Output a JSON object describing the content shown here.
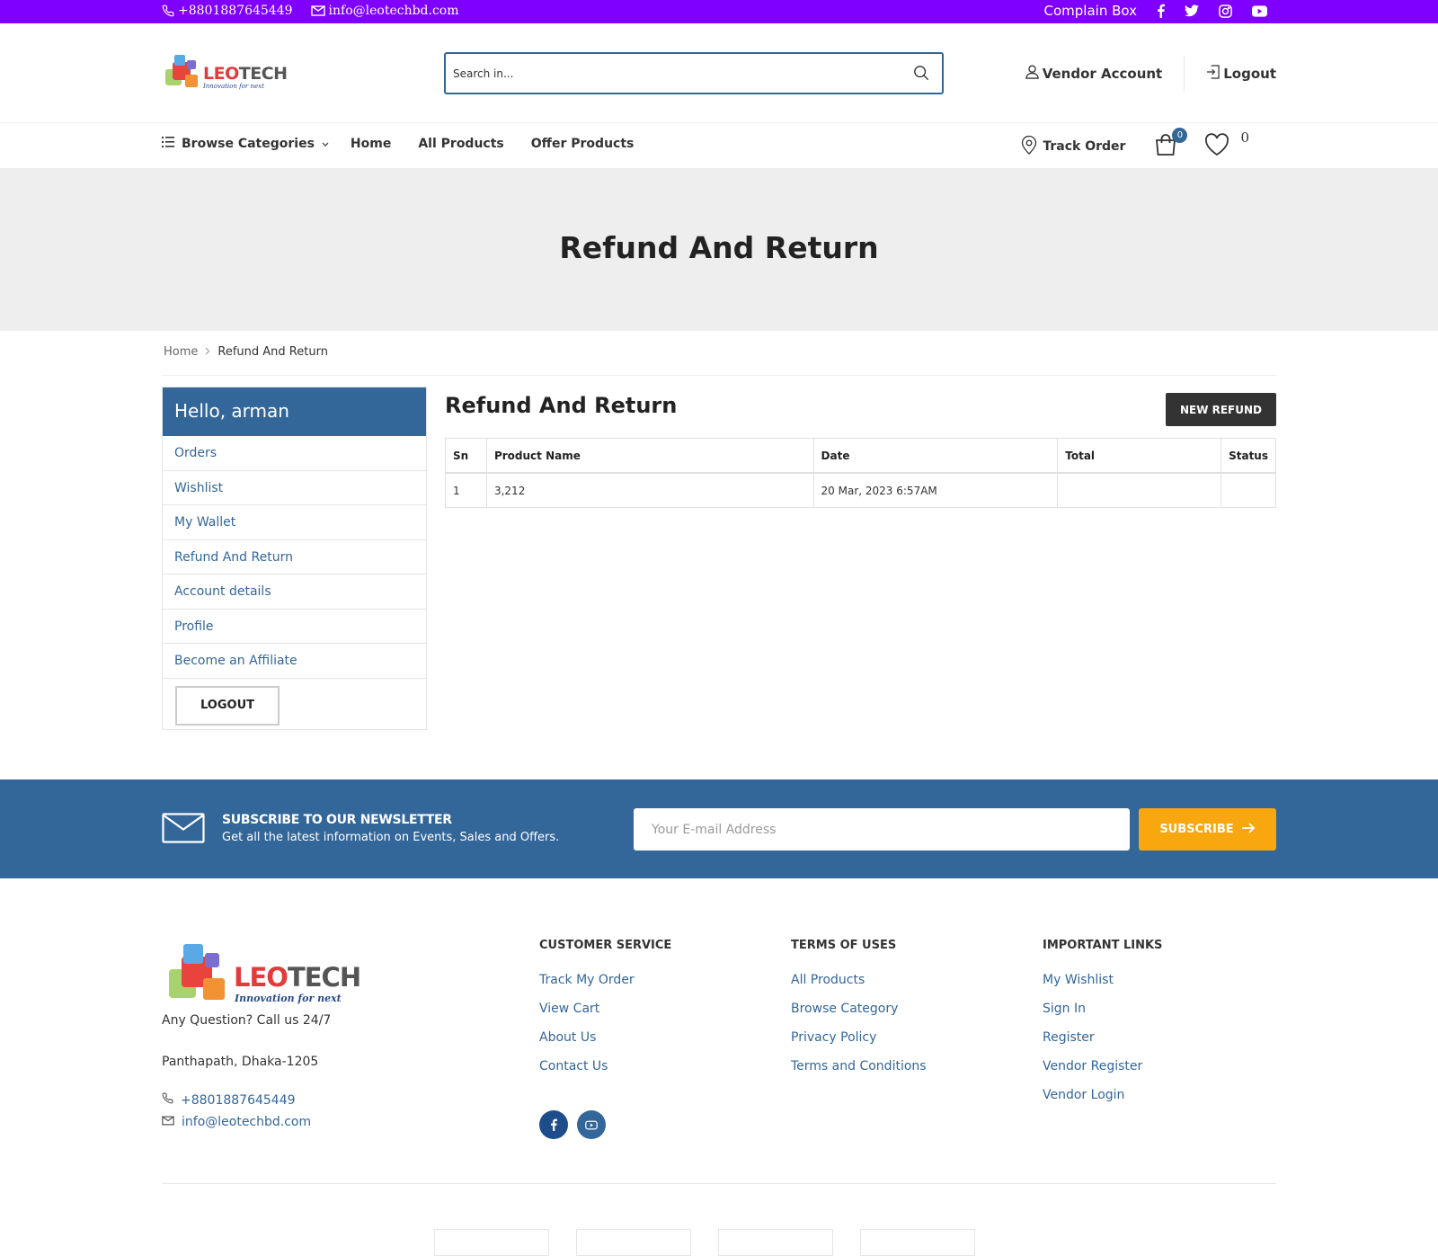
{
  "topbar": {
    "phone": "+8801887645449",
    "email": "info@leotechbd.com",
    "complain": "Complain Box",
    "social_icons": [
      "facebook-icon",
      "twitter-icon",
      "instagram-icon",
      "youtube-icon"
    ]
  },
  "brand": {
    "logo_leo": "LEO",
    "logo_tech": "TECH",
    "tagline": "Innovation for next",
    "colors": {
      "primary": "#336699",
      "topbar": "#8000ff",
      "accent": "#f9a70e"
    }
  },
  "search": {
    "placeholder": "Search in..."
  },
  "header": {
    "vendor_account": "Vendor Account",
    "logout": "Logout"
  },
  "nav": {
    "browse": "Browse Categories",
    "links": [
      "Home",
      "All Products",
      "Offer Products"
    ],
    "track_order": "Track Order",
    "cart_count": "0",
    "wishlist_count": "0"
  },
  "banner": {
    "title": "Refund And Return"
  },
  "breadcrumb": {
    "home": "Home",
    "current": "Refund And Return"
  },
  "sidebar": {
    "greeting": "Hello, arman",
    "items": [
      "Orders",
      "Wishlist",
      "My Wallet",
      "Refund And Return",
      "Account details",
      "Profile",
      "Become an Affiliate"
    ],
    "logout": "LOGOUT"
  },
  "content": {
    "title": "Refund And Return",
    "new_refund": "NEW REFUND",
    "columns": [
      "Sn",
      "Product Name",
      "Date",
      "Total",
      "Status"
    ],
    "rows": [
      {
        "sn": "1",
        "product": "3,212",
        "date": "20 Mar, 2023 6:57AM",
        "total": "",
        "status": ""
      }
    ]
  },
  "newsletter": {
    "title": "SUBSCRIBE TO OUR NEWSLETTER",
    "subtitle": "Get all the latest information on Events, Sales and Offers.",
    "placeholder": "Your E-mail Address",
    "button": "SUBSCRIBE"
  },
  "footer": {
    "question": "Any Question? Call us 24/7",
    "address": "Panthapath, Dhaka-1205",
    "phone": "+8801887645449",
    "email": "info@leotechbd.com",
    "customer_service": {
      "title": "CUSTOMER SERVICE",
      "links": [
        "Track My Order",
        "View Cart",
        "About Us",
        "Contact Us"
      ]
    },
    "terms": {
      "title": "TERMS OF USES",
      "links": [
        "All Products",
        "Browse Category",
        "Privacy Policy",
        "Terms and Conditions"
      ]
    },
    "important": {
      "title": "IMPORTANT LINKS",
      "links": [
        "My Wishlist",
        "Sign In",
        "Register",
        "Vendor Register",
        "Vendor Login"
      ]
    },
    "social_icons": [
      "facebook-icon",
      "youtube-icon"
    ]
  }
}
